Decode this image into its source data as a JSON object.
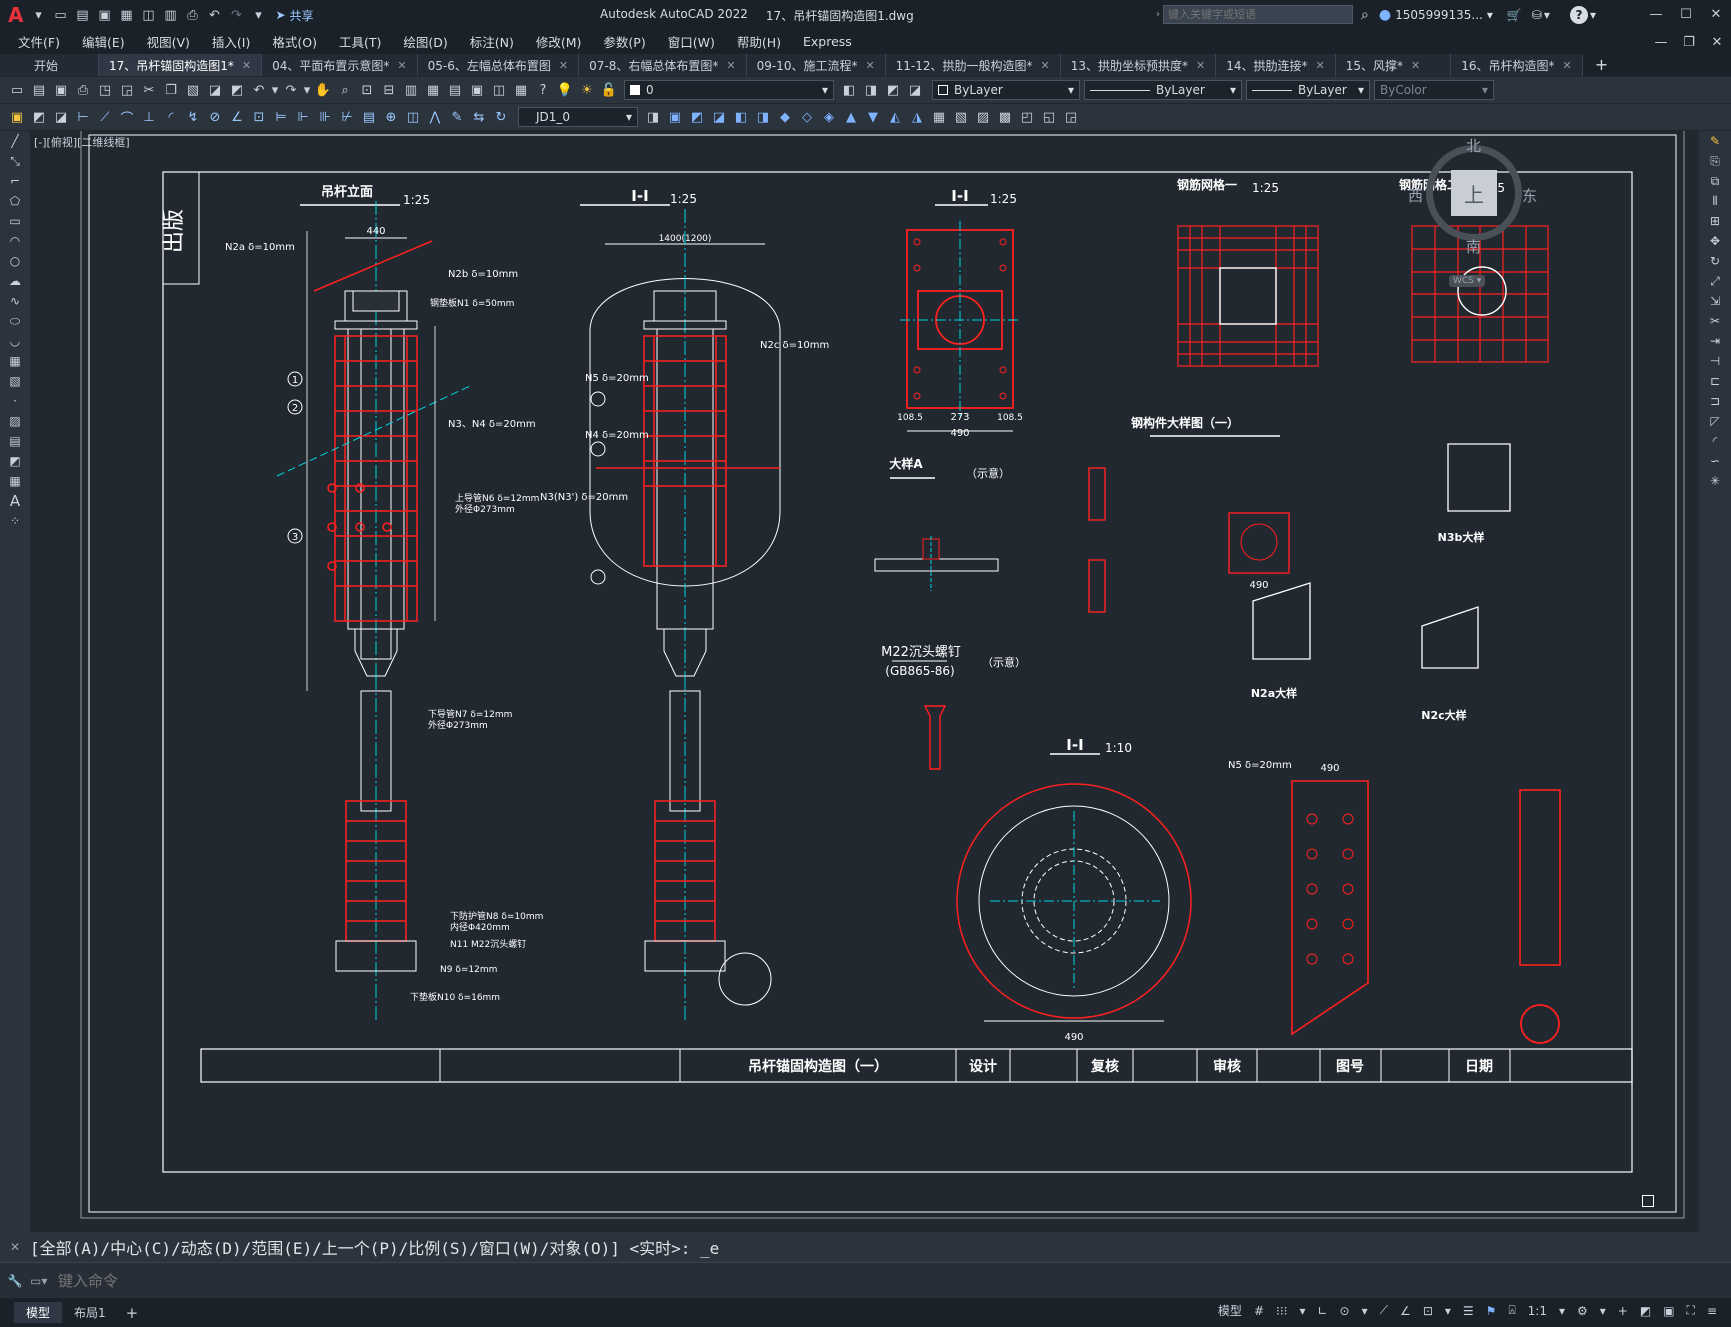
{
  "titlebar": {
    "app_logo": "A",
    "share_label": "共享",
    "title": "Autodesk AutoCAD 2022",
    "filename": "17、吊杆锚固构造图1.dwg",
    "search_placeholder": "键入关键字或短语",
    "user": "1505999135...",
    "icons": [
      "new-icon",
      "open-icon",
      "save-icon",
      "saveas-icon",
      "web-icon",
      "print-icon",
      "undo-icon",
      "redo-icon",
      "share-icon"
    ]
  },
  "menu": [
    "文件(F)",
    "编辑(E)",
    "视图(V)",
    "插入(I)",
    "格式(O)",
    "工具(T)",
    "绘图(D)",
    "标注(N)",
    "修改(M)",
    "参数(P)",
    "窗口(W)",
    "帮助(H)",
    "Express"
  ],
  "tabs": [
    {
      "label": "开始",
      "active": false,
      "closable": false
    },
    {
      "label": "17、吊杆锚固构造图1*",
      "active": true,
      "closable": true
    },
    {
      "label": "04、平面布置示意图*",
      "active": false,
      "closable": true
    },
    {
      "label": "05-6、左幅总体布置图",
      "active": false,
      "closable": true
    },
    {
      "label": "07-8、右幅总体布置图*",
      "active": false,
      "closable": true
    },
    {
      "label": "09-10、施工流程*",
      "active": false,
      "closable": true
    },
    {
      "label": "11-12、拱肋一般构造图*",
      "active": false,
      "closable": true
    },
    {
      "label": "13、拱肋坐标预拱度*",
      "active": false,
      "closable": true
    },
    {
      "label": "14、拱肋连接*",
      "active": false,
      "closable": true
    },
    {
      "label": "15、风撑*",
      "active": false,
      "closable": true
    },
    {
      "label": "16、吊杆构造图*",
      "active": false,
      "closable": true
    }
  ],
  "toolbar": {
    "layer_value": "0",
    "color_value": "ByLayer",
    "linetype_value": "ByLayer",
    "lineweight_value": "ByLayer",
    "plotstyle_value": "ByColor",
    "dimstyle_value": "JD1_0"
  },
  "viewport_label": "[-][俯视][二维线框]",
  "viewcube": {
    "north": "北",
    "south": "南",
    "east": "东",
    "west": "西",
    "top": "上",
    "wcs": "WCS"
  },
  "drawing": {
    "side_label": "出版",
    "views": {
      "elev": "吊杆立面",
      "sec1": "Ⅰ-Ⅰ",
      "sec2": "Ⅰ-Ⅰ",
      "net1": "钢筋网格一",
      "net2": "钢筋网格二",
      "detailA": "大样A",
      "detail_note": "（示意）",
      "bolt": "M22沉头螺钉",
      "bolt_std": "(GB865-86)",
      "steel_detail": "钢构件大样图（一）",
      "n3b": "N3b大样",
      "n2a": "N2a大样",
      "n2c": "N2c大样",
      "sec3": "Ⅰ-Ⅰ",
      "scale_125": "1:25",
      "scale_110": "1:10"
    },
    "callouts": {
      "n2a": "N2a δ=10mm",
      "n2b": "N2b δ=10mm",
      "n1": "钢垫板N1 δ=50mm",
      "n3n4": "N3、N4 δ=20mm",
      "n6": "上导管N6 δ=12mm",
      "n6b": "外径Φ273mm",
      "n7": "下导管N7 δ=12mm",
      "n7b": "外径Φ273mm",
      "n8": "下防护管N8 δ=10mm",
      "n8b": "内径Φ420mm",
      "n11": "N11 M22沉头螺钉",
      "n9": "N9 δ=12mm",
      "n10": "下垫板N10 δ=16mm",
      "n5": "N5 δ=20mm",
      "n4": "N4 δ=20mm",
      "n33": "N3(N3') δ=20mm",
      "n2c": "N2c δ=10mm"
    },
    "dims": {
      "d440": "440",
      "d1400": "1400(1200)",
      "d490": "490",
      "d273": "273",
      "d1085": "108.5"
    },
    "titleblock": {
      "title": "吊杆锚固构造图（一）",
      "design": "设计",
      "review": "复核",
      "audit": "审核",
      "drawing_no": "图号",
      "date": "日期"
    }
  },
  "command": {
    "history": "[全部(A)/中心(C)/动态(D)/范围(E)/上一个(P)/比例(S)/窗口(W)/对象(O)] <实时>: _e",
    "input_placeholder": "键入命令"
  },
  "status": {
    "layout_tabs": [
      "模型",
      "布局1"
    ],
    "model_label": "模型",
    "scale": "1:1"
  }
}
